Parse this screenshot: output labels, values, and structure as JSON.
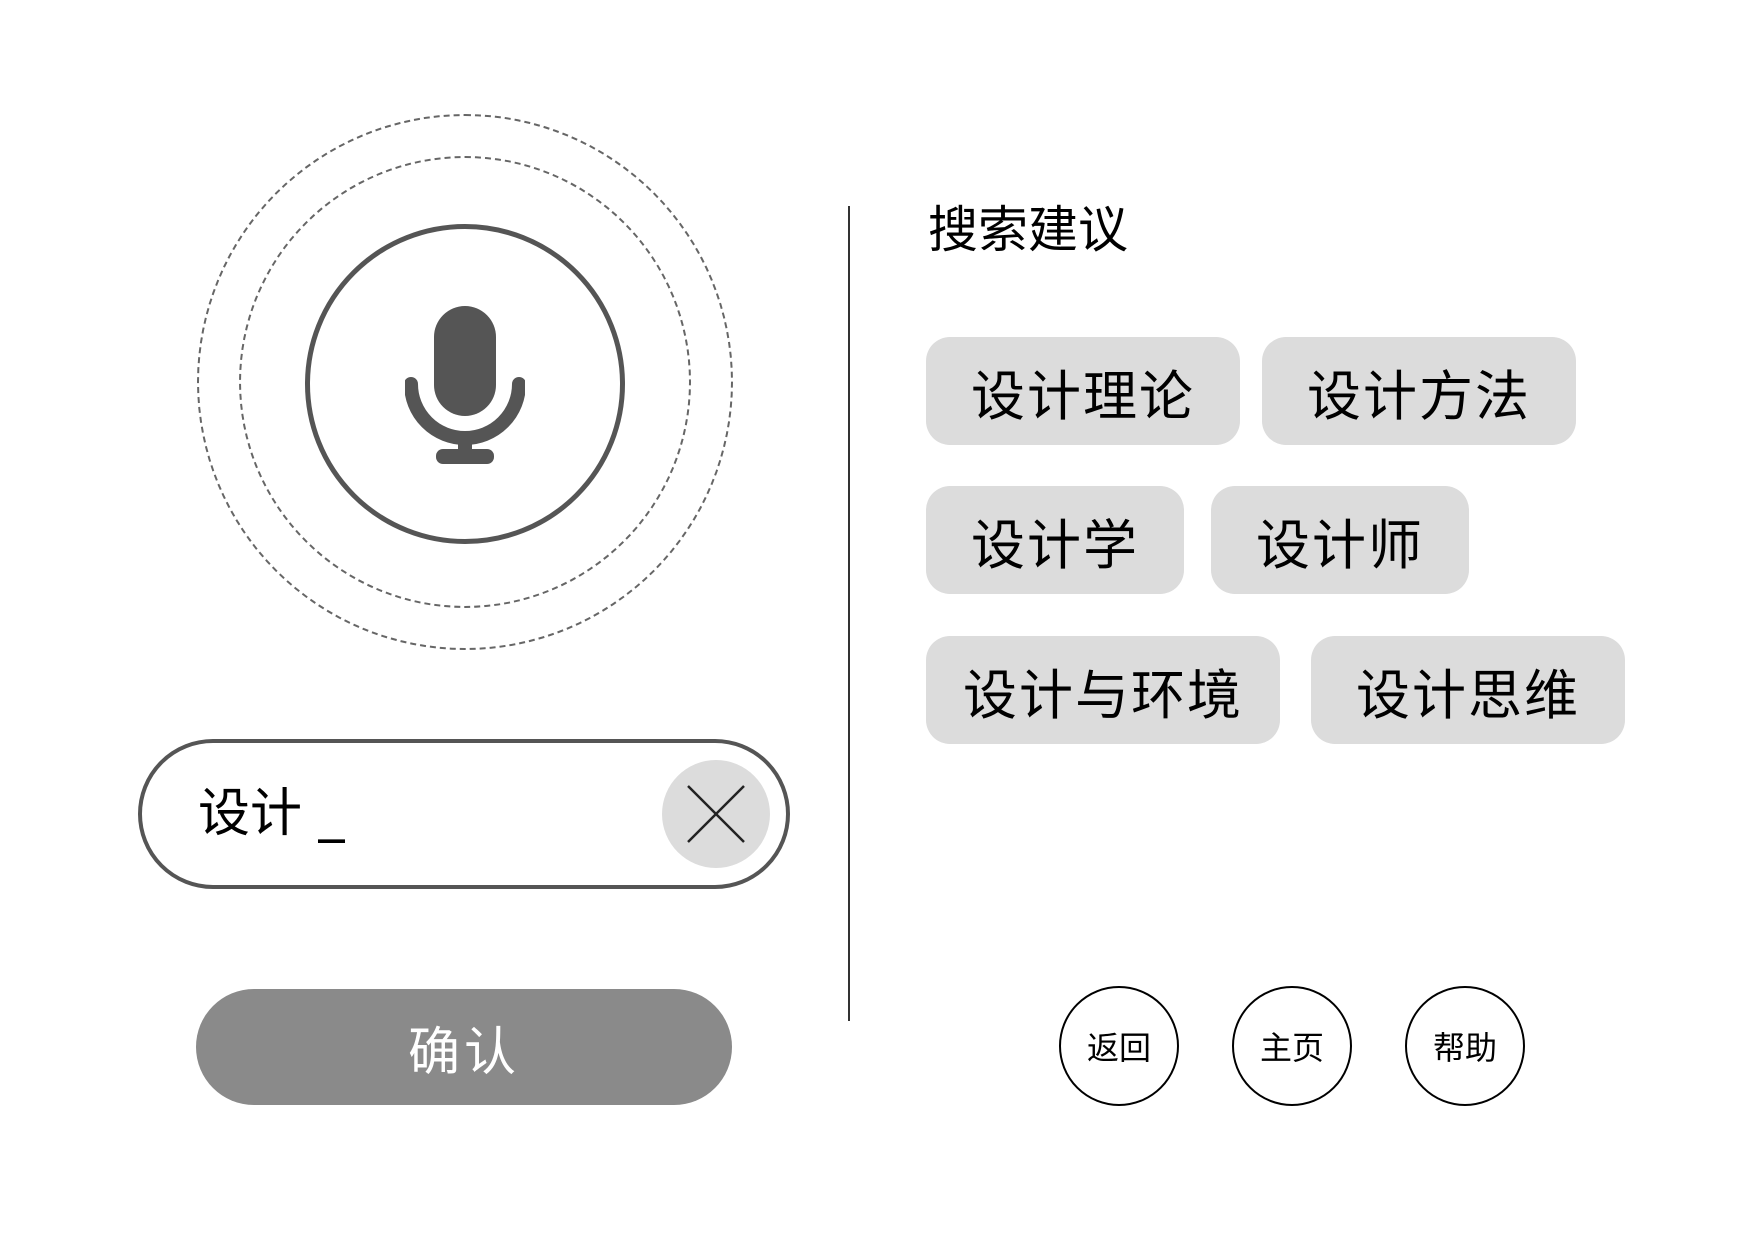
{
  "voice": {
    "mic_icon": "microphone-icon"
  },
  "search": {
    "value": "设计 _",
    "clear_icon": "close-icon"
  },
  "confirm_label": "确认",
  "suggestions": {
    "title": "搜索建议",
    "items": [
      "设计理论",
      "设计方法",
      "设计学",
      "设计师",
      "设计与环境",
      "设计思维"
    ]
  },
  "nav": {
    "back": "返回",
    "home": "主页",
    "help": "帮助"
  },
  "colors": {
    "chip_bg": "#dcdcdc",
    "confirm_bg": "#8a8a8a",
    "icon": "#555555"
  }
}
